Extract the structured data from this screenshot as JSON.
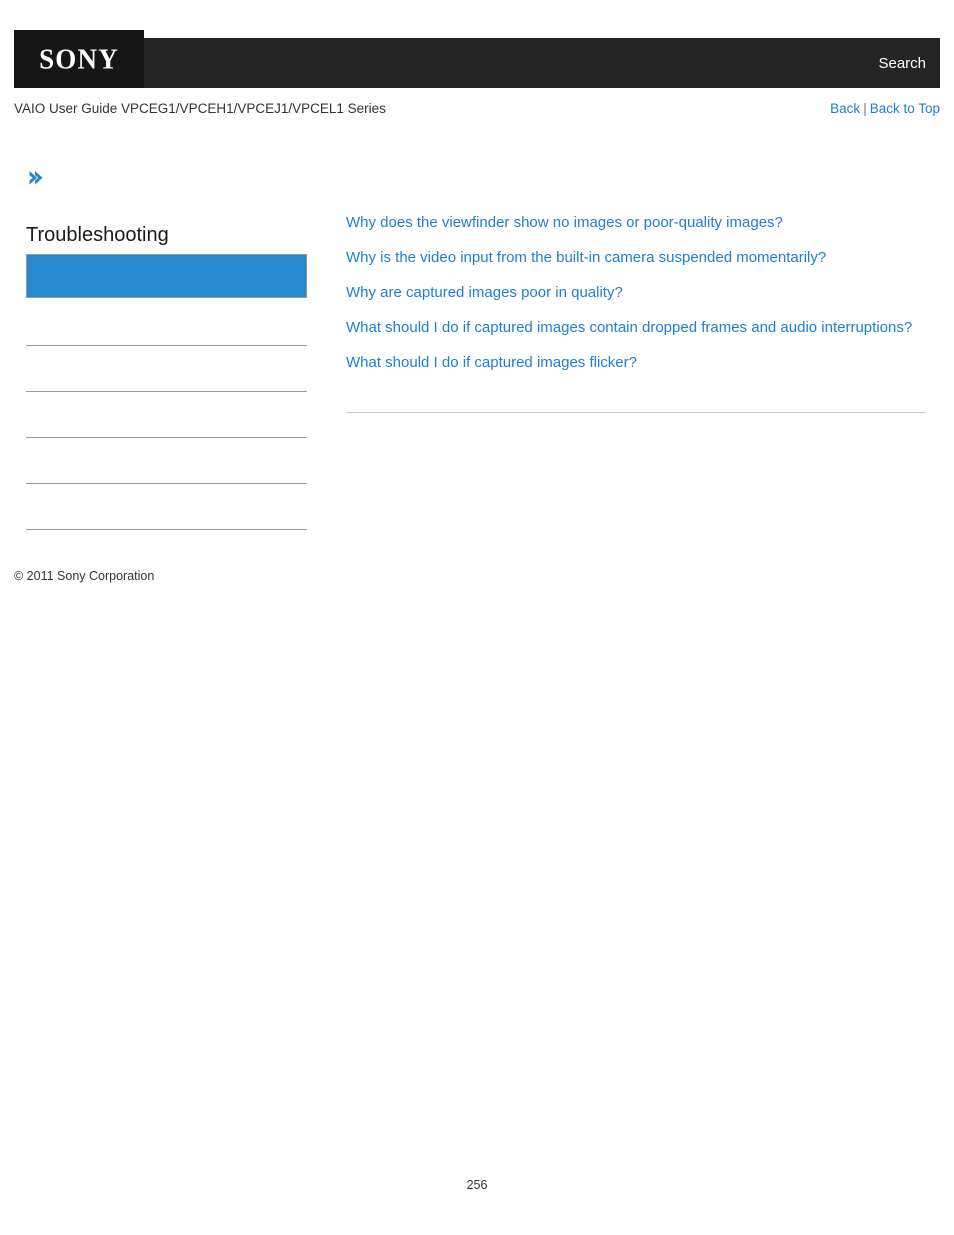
{
  "header": {
    "logo": "SONY",
    "search_label": "Search"
  },
  "subheader": {
    "guide_title": "VAIO User Guide VPCEG1/VPCEH1/VPCEJ1/VPCEL1 Series",
    "back_label": "Back",
    "separator": "|",
    "back_to_top_label": "Back to Top"
  },
  "sidebar": {
    "breadcrumb_icon": "chevron-right-icon",
    "section_title": "Troubleshooting",
    "active_item_label": "",
    "items": [
      {
        "label": ""
      },
      {
        "label": ""
      },
      {
        "label": ""
      },
      {
        "label": ""
      },
      {
        "label": ""
      }
    ],
    "copyright": "© 2011 Sony Corporation"
  },
  "main": {
    "links": [
      {
        "label": "Why does the viewfinder show no images or poor-quality images?"
      },
      {
        "label": "Why is the video input from the built-in camera suspended momentarily?"
      },
      {
        "label": "Why are captured images poor in quality?"
      },
      {
        "label": "What should I do if captured images contain dropped frames and audio interruptions?"
      },
      {
        "label": "What should I do if captured images flicker?"
      }
    ]
  },
  "footer": {
    "page_number": "256"
  },
  "colors": {
    "header_bar": "#252525",
    "logo_box": "#161616",
    "accent_blue": "#2689ce",
    "link_blue": "#1e7fd0",
    "divider_gray": "#9a9a9a",
    "content_divider_gray": "#cccccc"
  }
}
